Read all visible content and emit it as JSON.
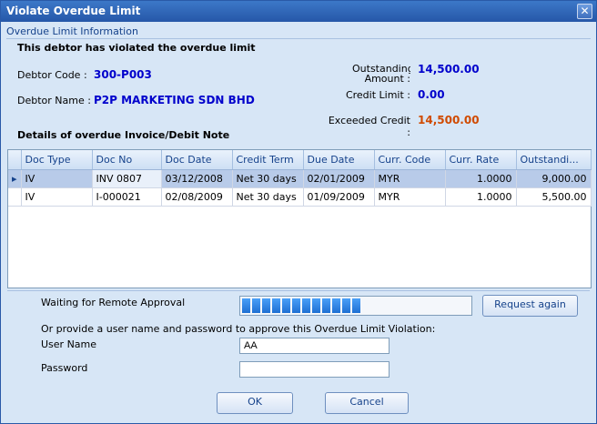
{
  "window": {
    "title": "Violate Overdue Limit",
    "close_label": "✕"
  },
  "info": {
    "section_caption": "Overdue Limit Information",
    "headline": "This debtor has violated the overdue limit",
    "debtor_code_label": "Debtor Code :",
    "debtor_code": "300-P003",
    "debtor_name_label": "Debtor Name :",
    "debtor_name": "P2P MARKETING SDN BHD",
    "outstanding_label": "Outstanding Amount :",
    "outstanding_value": "14,500.00",
    "credit_limit_label": "Credit Limit :",
    "credit_limit_value": "0.00",
    "exceeded_label": "Exceeded Credit :",
    "exceeded_value": "14,500.00",
    "details_title": "Details of overdue Invoice/Debit Note"
  },
  "grid": {
    "columns": [
      "Doc Type",
      "Doc No",
      "Doc Date",
      "Credit Term",
      "Due Date",
      "Curr. Code",
      "Curr. Rate",
      "Outstandi..."
    ],
    "rows": [
      [
        "IV",
        "INV 0807",
        "03/12/2008",
        "Net 30 days",
        "02/01/2009",
        "MYR",
        "1.0000",
        "9,000.00"
      ],
      [
        "IV",
        "I-000021",
        "02/08/2009",
        "Net 30 days",
        "01/09/2009",
        "MYR",
        "1.0000",
        "5,500.00"
      ]
    ],
    "selected_row": 0,
    "row_indicator": "▸"
  },
  "approval": {
    "waiting_label": "Waiting for Remote Approval",
    "progress_fraction": 0.52,
    "request_again_label": "Request again",
    "instruction": "Or provide a user name and password to approve this Overdue Limit Violation:",
    "user_name_label": "User Name",
    "user_name_value": "AA",
    "password_label": "Password",
    "password_value": ""
  },
  "buttons": {
    "ok_label": "OK",
    "cancel_label": "Cancel"
  },
  "colors": {
    "value_blue": "#0000cc",
    "exceeded_orange": "#d04a00",
    "title_bar": "#2f67b6"
  }
}
